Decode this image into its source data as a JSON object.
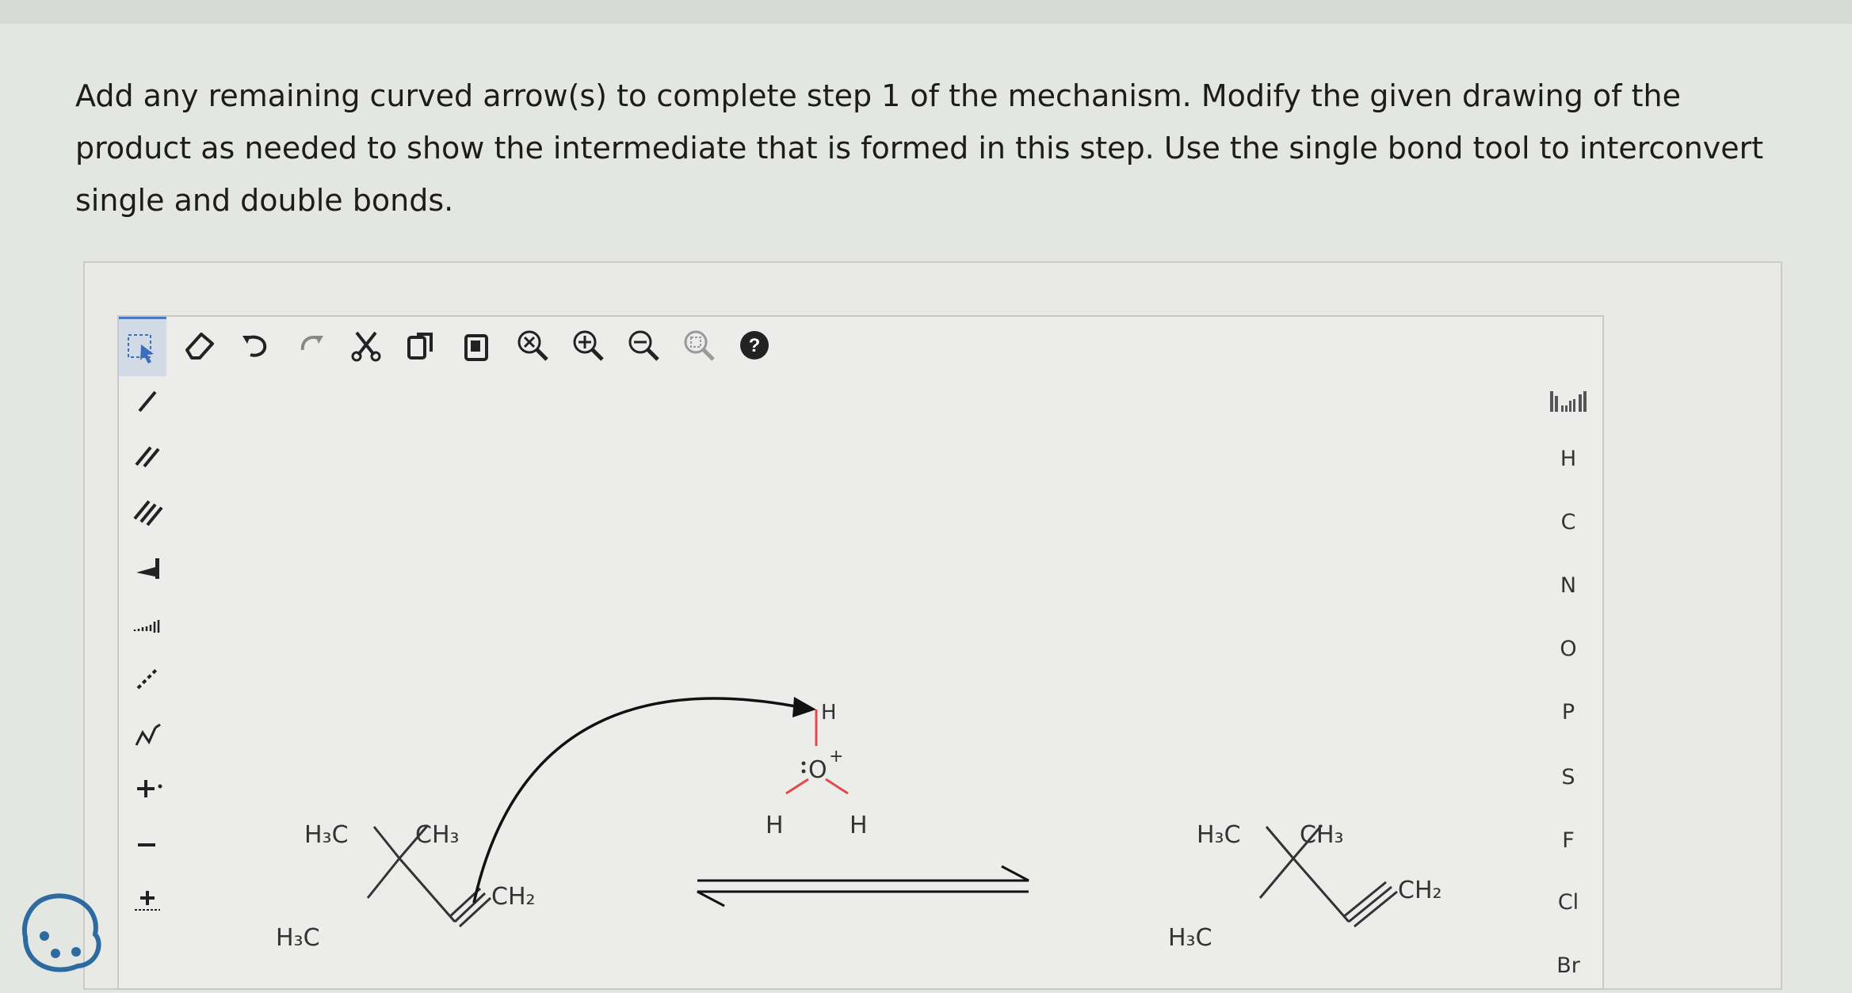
{
  "prompt": "Add any remaining curved arrow(s) to complete step 1 of the mechanism. Modify the given drawing of the product as needed to show the intermediate that is formed in this step. Use the single bond tool to interconvert single and double bonds.",
  "toolbar": {
    "help_label": "?"
  },
  "elements": [
    "H",
    "C",
    "N",
    "O",
    "P",
    "S",
    "F",
    "Cl",
    "Br"
  ],
  "reactant": {
    "label_h3c_top": "H₃C",
    "label_ch3_top": "CH₃",
    "label_h3c_bottom": "H₃C",
    "label_ch2": "CH₂"
  },
  "hydronium": {
    "label_o": "O",
    "label_charge": "+",
    "label_h_top": "H",
    "label_h_left": "H",
    "label_h_right": "H"
  },
  "product": {
    "label_h3c_top": "H₃C",
    "label_ch3_top": "CH₃",
    "label_h3c_bottom": "H₃C",
    "label_ch2": "CH₂"
  }
}
